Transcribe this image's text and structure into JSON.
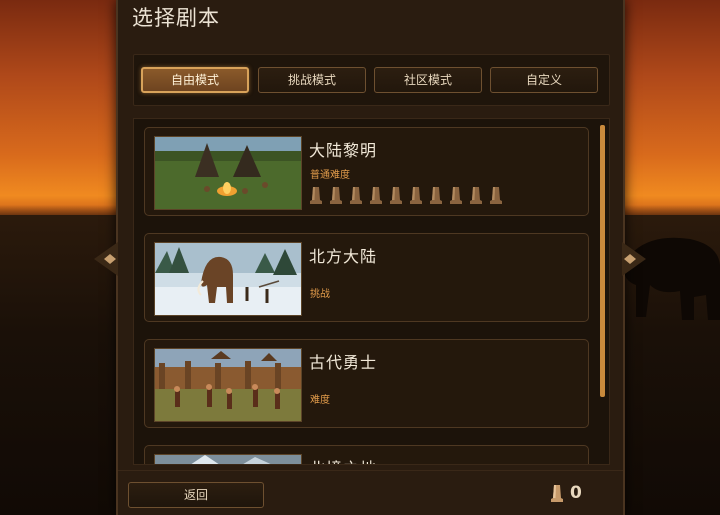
{
  "screen": {
    "title": "选择剧本"
  },
  "tabs": [
    {
      "label": "自由模式",
      "active": true
    },
    {
      "label": "挑战模式",
      "active": false
    },
    {
      "label": "社区模式",
      "active": false
    },
    {
      "label": "自定义",
      "active": false
    }
  ],
  "scenarios": [
    {
      "name": "大陆黎明",
      "difficulty": "普通难度",
      "tokens": 10,
      "thumb": "camp-tents-icon"
    },
    {
      "name": "北方大陆",
      "difficulty": "挑战",
      "tokens": 0,
      "thumb": "mammoth-snow-icon"
    },
    {
      "name": "古代勇士",
      "difficulty": "难度",
      "tokens": 0,
      "thumb": "palisade-village-icon"
    },
    {
      "name": "北境之地",
      "difficulty": "",
      "tokens": 0,
      "thumb": "snowy-mountain-icon"
    }
  ],
  "footer": {
    "back_label": "返回",
    "token_count": "0"
  },
  "colors": {
    "accent": "#d8a25a",
    "difficulty_text": "#e09a4a",
    "scrollbar": "#c98a3c",
    "panel_bg": "#2a1c10"
  }
}
